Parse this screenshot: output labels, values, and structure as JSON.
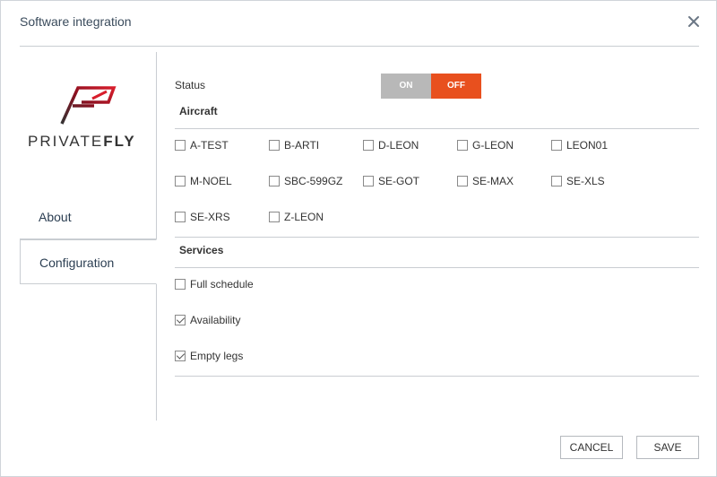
{
  "dialog": {
    "title": "Software integration",
    "close_icon": "close-icon"
  },
  "logo": {
    "brand_left": "PRIVATE",
    "brand_right": "FLY",
    "mark_color": "#c8102e"
  },
  "nav": {
    "tabs": [
      {
        "label": "About",
        "active": false
      },
      {
        "label": "Configuration",
        "active": true
      }
    ]
  },
  "status": {
    "label": "Status",
    "on_label": "ON",
    "off_label": "OFF",
    "value": "OFF",
    "on_color": "#b8b8b8",
    "off_color": "#e8501e"
  },
  "aircraft": {
    "title": "Aircraft",
    "items": [
      {
        "label": "A-TEST",
        "checked": false
      },
      {
        "label": "B-ARTI",
        "checked": false
      },
      {
        "label": "D-LEON",
        "checked": false
      },
      {
        "label": "G-LEON",
        "checked": false
      },
      {
        "label": "LEON01",
        "checked": false
      },
      {
        "label": "M-NOEL",
        "checked": false
      },
      {
        "label": "SBC-599GZ",
        "checked": false
      },
      {
        "label": "SE-GOT",
        "checked": false
      },
      {
        "label": "SE-MAX",
        "checked": false
      },
      {
        "label": "SE-XLS",
        "checked": false
      },
      {
        "label": "SE-XRS",
        "checked": false
      },
      {
        "label": "Z-LEON",
        "checked": false
      }
    ]
  },
  "services": {
    "title": "Services",
    "items": [
      {
        "label": "Full schedule",
        "checked": false
      },
      {
        "label": "Availability",
        "checked": true
      },
      {
        "label": "Empty legs",
        "checked": true
      }
    ]
  },
  "footer": {
    "cancel_label": "CANCEL",
    "save_label": "SAVE"
  }
}
